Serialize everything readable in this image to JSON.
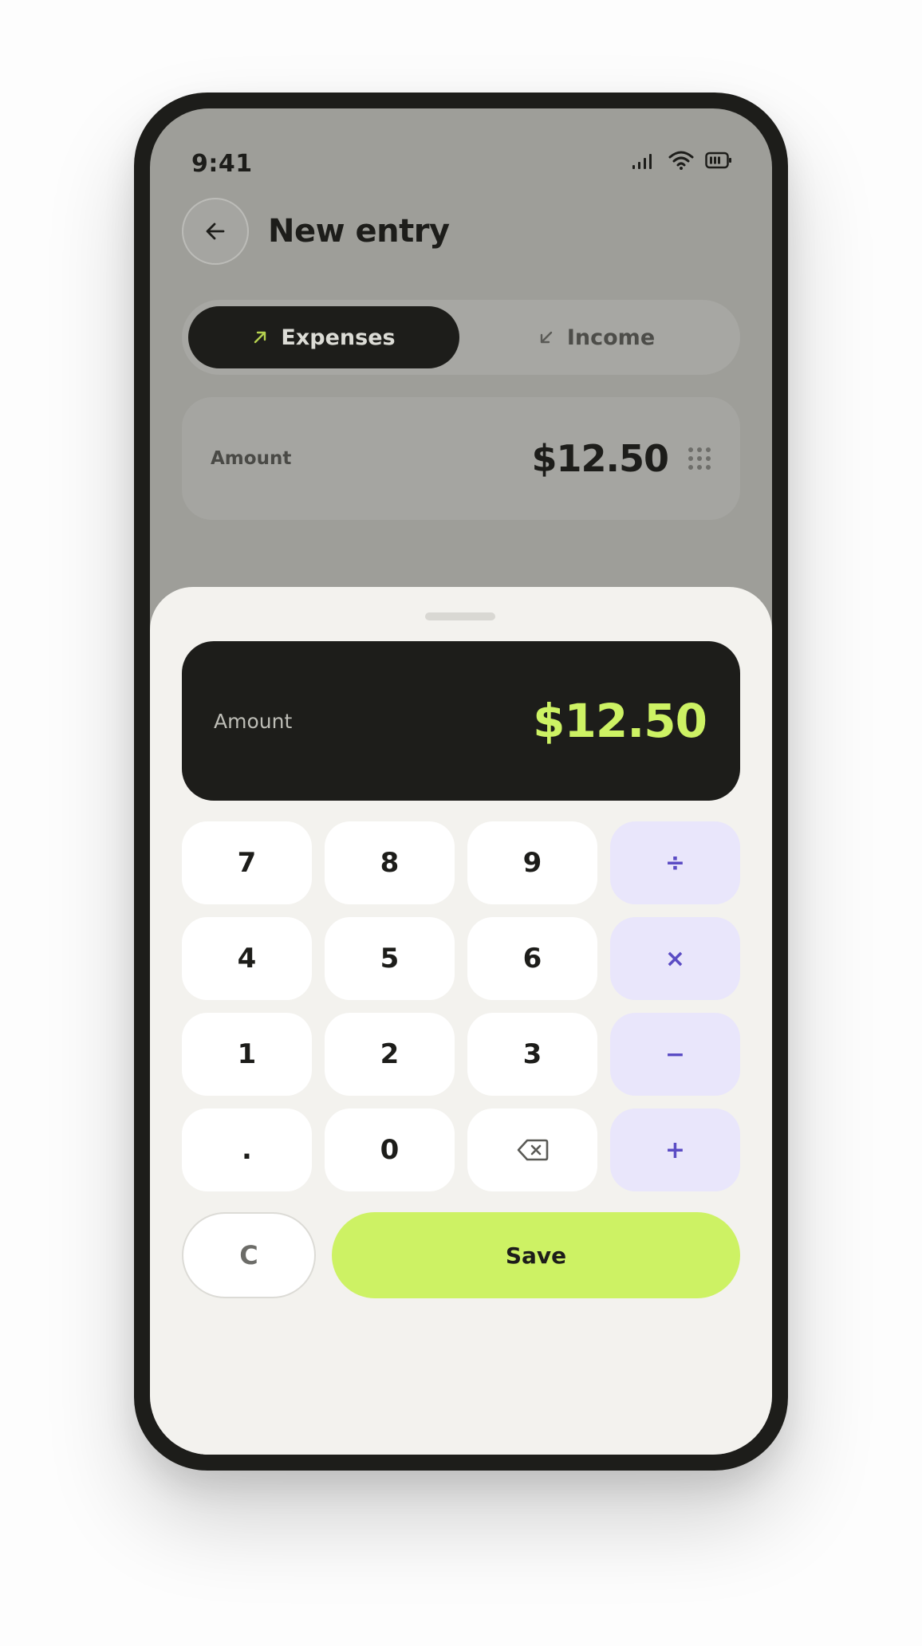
{
  "status": {
    "time": "9:41"
  },
  "header": {
    "title": "New entry"
  },
  "tabs": [
    {
      "label": "Expenses",
      "icon": "arrow-up-right-icon",
      "active": true
    },
    {
      "label": "Income",
      "icon": "arrow-down-left-icon",
      "active": false
    }
  ],
  "amount_field": {
    "label": "Amount",
    "value": "$12.50"
  },
  "sheet": {
    "display": {
      "label": "Amount",
      "value": "$12.50"
    },
    "keys": [
      "7",
      "8",
      "9",
      "÷",
      "4",
      "5",
      "6",
      "×",
      "1",
      "2",
      "3",
      "−",
      ".",
      "0",
      "⌫",
      "+"
    ],
    "clear_label": "C",
    "save_label": "Save"
  },
  "colors": {
    "accent": "#cdf264",
    "dark": "#1d1d1a",
    "operator_bg": "#e9e6fb",
    "operator_fg": "#5b4cc4"
  }
}
